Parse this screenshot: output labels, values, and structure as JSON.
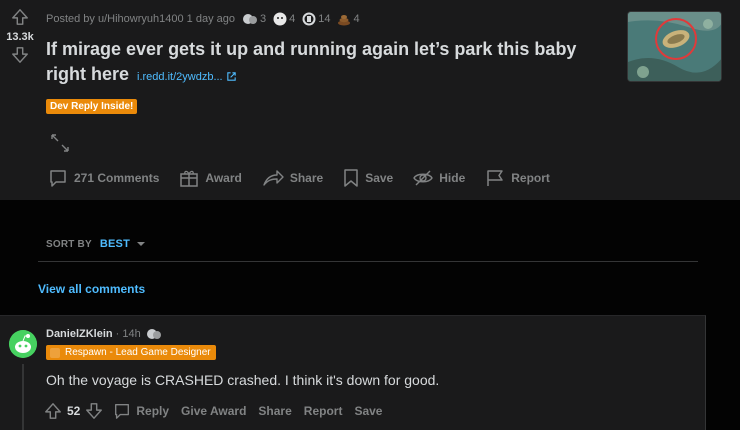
{
  "post": {
    "score": "13.3k",
    "meta_posted_by": "Posted by u/Hihowryuh1400",
    "meta_time": "1 day ago",
    "awards": [
      {
        "icon": "helpful-award-icon",
        "count": "3"
      },
      {
        "icon": "wholesome-award-icon",
        "count": "4"
      },
      {
        "icon": "silver-award-icon",
        "count": "14"
      },
      {
        "icon": "poop-award-icon",
        "count": "4"
      }
    ],
    "title": "If mirage ever gets it up and running again let’s park this baby right here",
    "link_text": "i.redd.it/2ywdzb...",
    "flair": "Dev Reply Inside!",
    "actions": {
      "comments": "271 Comments",
      "award": "Award",
      "share": "Share",
      "save": "Save",
      "hide": "Hide",
      "report": "Report"
    }
  },
  "sort": {
    "label": "SORT BY",
    "value": "BEST"
  },
  "view_all": "View all comments",
  "comment": {
    "author": "DanielZKlein",
    "time": "· 14h",
    "flair": "Respawn - Lead Game Designer",
    "body": "Oh the voyage is CRASHED crashed. I think it's down for good.",
    "score": "52",
    "actions": {
      "reply": "Reply",
      "give_award": "Give Award",
      "share": "Share",
      "report": "Report",
      "save": "Save"
    }
  },
  "colors": {
    "accent": "#4fbcff",
    "flair": "#ea8a0a",
    "avatar": "#46d160"
  }
}
